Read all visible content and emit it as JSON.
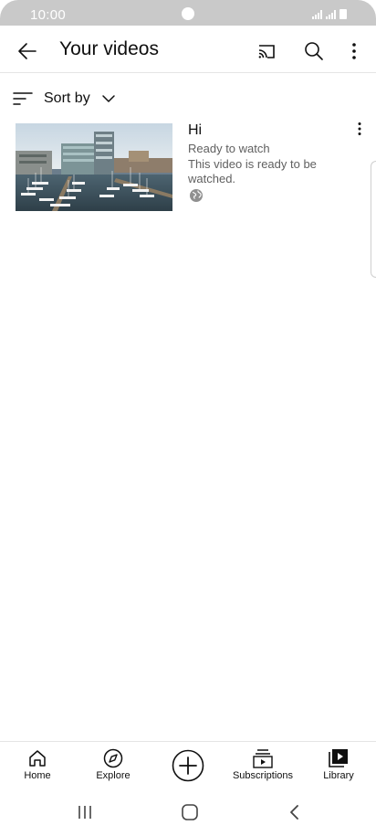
{
  "status_bar": {
    "time": "10:00"
  },
  "app_bar": {
    "title": "Your videos"
  },
  "sort": {
    "label": "Sort by"
  },
  "videos": [
    {
      "title": "Hi",
      "status": "Ready to watch",
      "description": "This video is ready to be watched.",
      "visibility_icon": "globe-icon"
    }
  ],
  "bottom_nav": {
    "items": [
      {
        "label": "Home",
        "icon": "home-icon"
      },
      {
        "label": "Explore",
        "icon": "compass-icon"
      },
      {
        "label": "",
        "icon": "plus-circle-icon"
      },
      {
        "label": "Subscriptions",
        "icon": "subscriptions-icon"
      },
      {
        "label": "Library",
        "icon": "library-icon"
      }
    ]
  },
  "colors": {
    "text_primary": "#0f0f0f",
    "text_secondary": "#606060",
    "status_bar": "#c9c9c9",
    "divider": "#e5e5e5"
  }
}
